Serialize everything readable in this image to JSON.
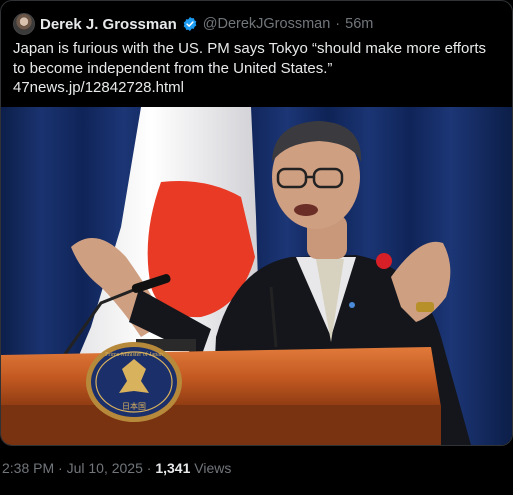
{
  "tweet": {
    "author": {
      "display_name": "Derek J. Grossman",
      "handle": "@DerekJGrossman",
      "verified": true
    },
    "separator": "·",
    "relative_time": "56m",
    "text": "Japan is furious with the US. PM says Tokyo “should make more efforts to become independent from the United States.”",
    "link": "47news.jp/12842728.html",
    "media": {
      "podium_seal_text": "日本国",
      "podium_seal_ring_text": "Prime Minister of Japan"
    }
  },
  "footer": {
    "timestamp": "2:38 PM · Jul 10, 2025",
    "separator": "·",
    "views_count": "1,341",
    "views_label": "Views"
  },
  "colors": {
    "background": "#000000",
    "text_primary": "#e7e9ea",
    "text_secondary": "#71767b",
    "verified_blue": "#1d9bf0",
    "border": "#2f3336"
  }
}
